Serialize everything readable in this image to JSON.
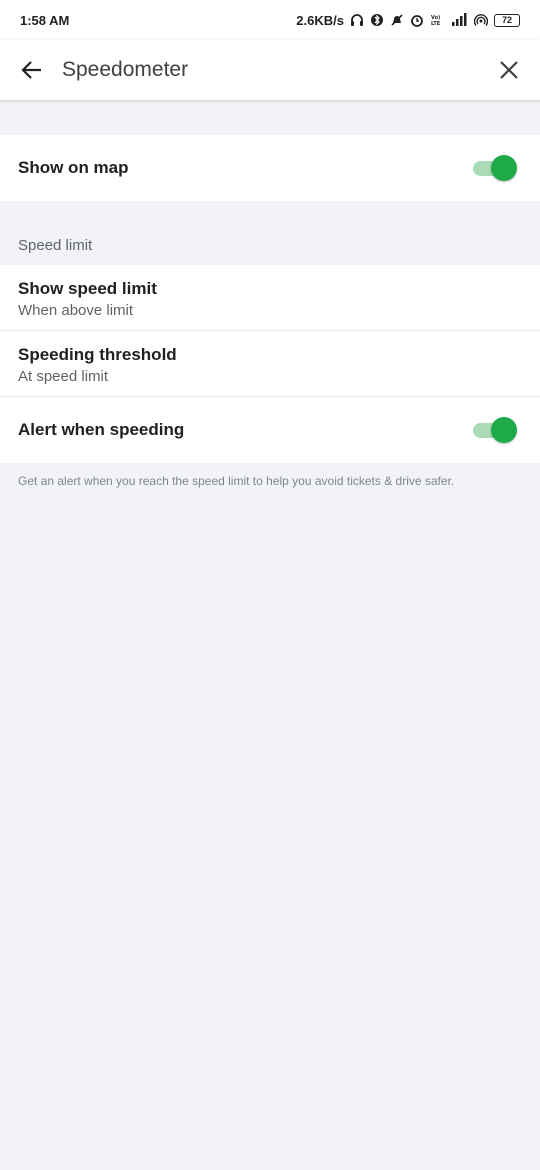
{
  "status_bar": {
    "time": "1:58 AM",
    "network_speed": "2.6KB/s",
    "battery_level": "72",
    "icons": [
      "headphones-icon",
      "bluetooth-icon",
      "mute-icon",
      "alarm-icon",
      "volte-icon",
      "signal-icon",
      "hotspot-icon",
      "battery-icon"
    ]
  },
  "app_bar": {
    "title": "Speedometer",
    "back_icon": "arrow-back-icon",
    "close_icon": "close-icon"
  },
  "show_on_map": {
    "label": "Show on map",
    "enabled": true
  },
  "speed_limit_section": {
    "header": "Speed limit",
    "show_speed_limit": {
      "label": "Show speed limit",
      "value": "When above limit"
    },
    "speeding_threshold": {
      "label": "Speeding threshold",
      "value": "At speed limit"
    },
    "alert_when_speeding": {
      "label": "Alert when speeding",
      "enabled": true
    }
  },
  "footnote": "Get an alert when you reach the speed limit to help you avoid tickets & drive safer.",
  "colors": {
    "accent": "#1faa4a",
    "accent_track": "#a9dbb6",
    "background": "#f1f3f7"
  }
}
